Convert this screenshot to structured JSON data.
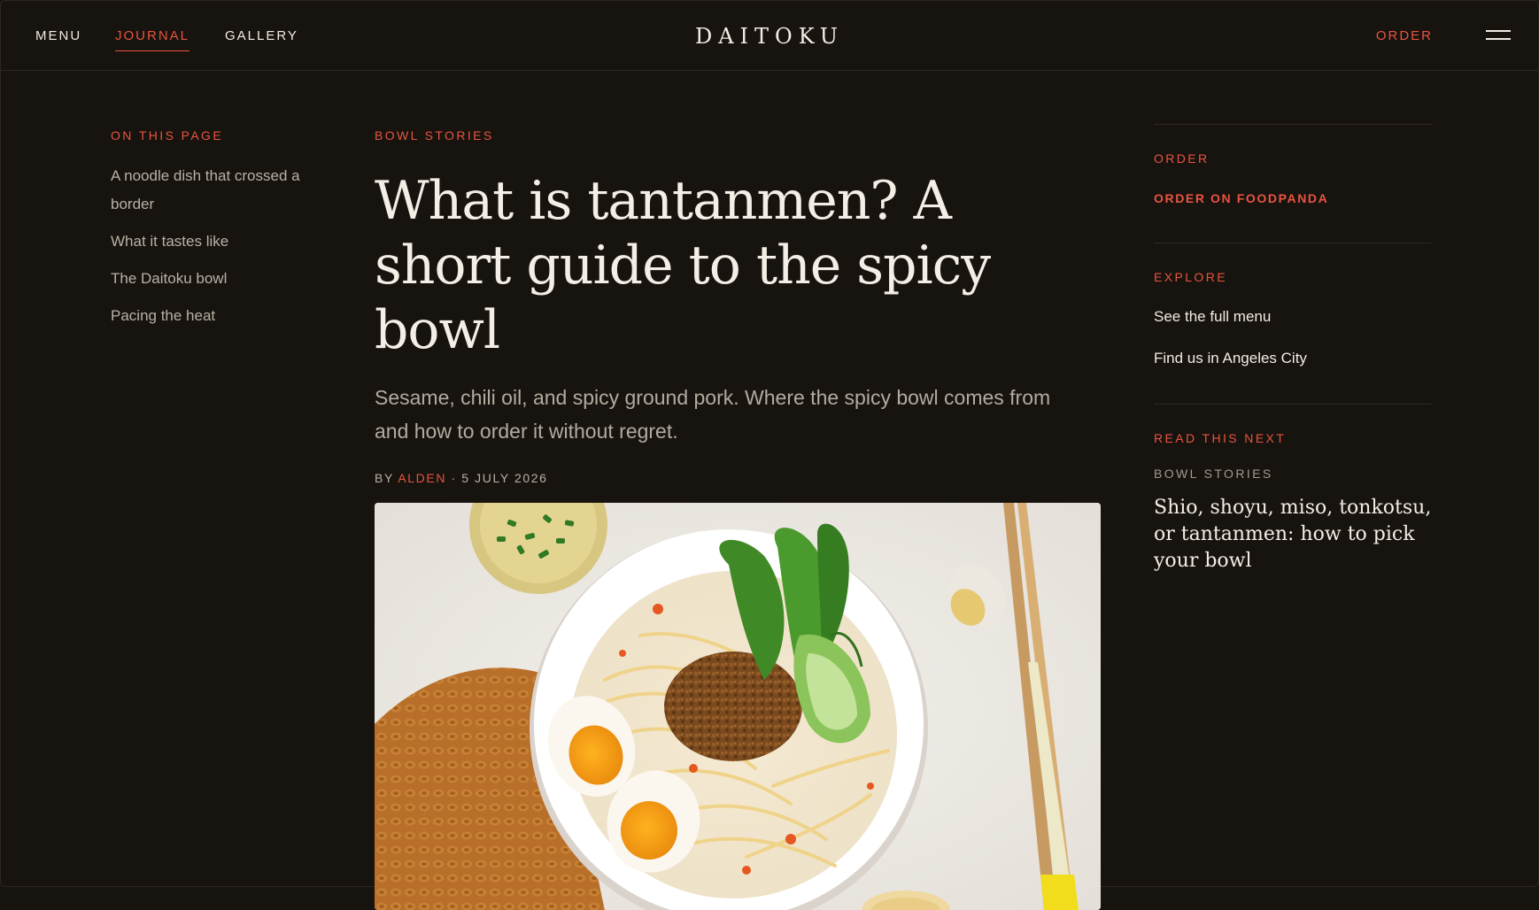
{
  "nav": {
    "menu": "MENU",
    "journal": "JOURNAL",
    "gallery": "GALLERY",
    "brand": "DAITOKU",
    "order": "ORDER"
  },
  "toc": {
    "heading": "ON THIS PAGE",
    "items": [
      "A noodle dish that crossed a border",
      "What it tastes like",
      "The Daitoku bowl",
      "Pacing the heat"
    ]
  },
  "article": {
    "category": "BOWL STORIES",
    "title": "What is tantanmen? A short guide to the spicy bowl",
    "dek": "Sesame, chili oil, and spicy ground pork. Where the spicy bowl comes from and how to order it without regret.",
    "by_label": "BY",
    "author": "ALDEN",
    "separator": "·",
    "date": "5 JULY 2026"
  },
  "sidebar": {
    "order_heading": "ORDER",
    "order_link": "ORDER ON FOODPANDA",
    "explore_heading": "EXPLORE",
    "explore_links": [
      "See the full menu",
      "Find us in Angeles City"
    ],
    "next_heading": "READ THIS NEXT",
    "next_category": "BOWL STORIES",
    "next_title": "Shio, shoyu, miso, tonkotsu, or tantanmen: how to pick your bowl"
  },
  "colors": {
    "background": "#17130f",
    "accent": "#e8553f",
    "text": "#f3efe6",
    "muted": "#b3ab9f"
  }
}
